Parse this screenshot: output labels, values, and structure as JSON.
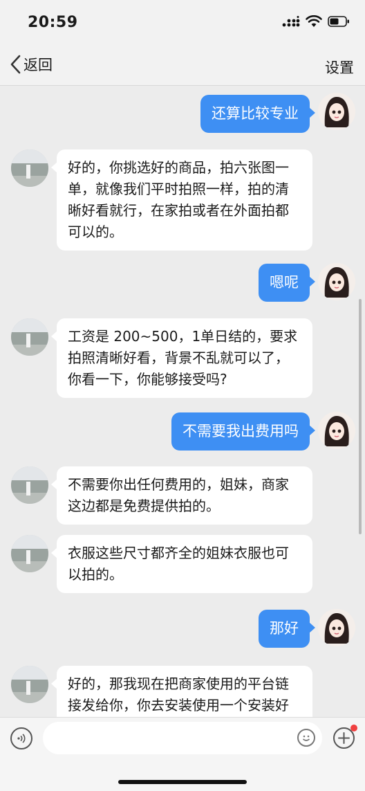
{
  "status_bar": {
    "time": "20:59"
  },
  "nav": {
    "back_label": "返回",
    "settings_label": "设置"
  },
  "messages": [
    {
      "side": "right",
      "text": "还算比较专业"
    },
    {
      "side": "left",
      "text": "好的，你挑选好的商品，拍六张图一单，就像我们平时拍照一样，拍的清晰好看就行，在家拍或者在外面拍都可以的。"
    },
    {
      "side": "right",
      "text": "嗯呢"
    },
    {
      "side": "left",
      "text": "工资是 200~500，1单日结的，要求拍照清晰好看，背景不乱就可以了，你看一下，你能够接受吗?"
    },
    {
      "side": "right",
      "text": "不需要我出费用吗"
    },
    {
      "side": "left",
      "text": "不需要你出任何费用的，姐妹，商家这边都是免费提供拍的。"
    },
    {
      "side": "left",
      "text": "衣服这些尺寸都齐全的姐妹衣服也可以拍的。"
    },
    {
      "side": "right",
      "text": "那好"
    },
    {
      "side": "left",
      "text": "好的，那我现在把商家使用的平台链接发给你，你去安装使用一个安装好了，我添加你一起这样你便于"
    }
  ],
  "input": {
    "value": "",
    "placeholder": ""
  },
  "colors": {
    "accent_blue": "#3e8ff3",
    "background": "#ececec",
    "bubble_white": "#ffffff"
  }
}
